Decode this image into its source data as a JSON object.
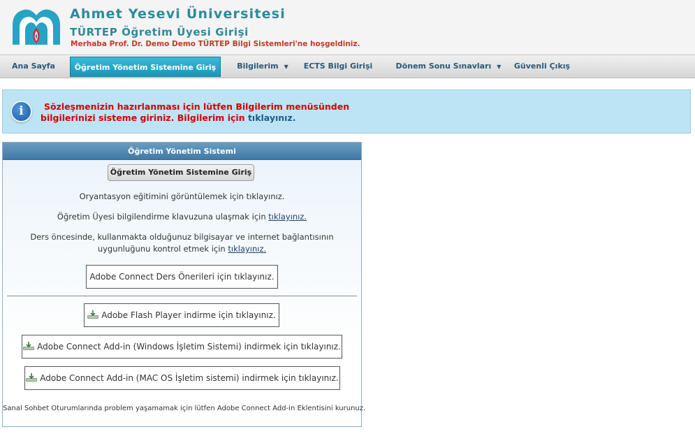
{
  "header": {
    "title": "Ahmet Yesevi Üniversitesi",
    "subtitle": "TÜRTEP Öğretim Üyesi Girişi",
    "welcome": "Merhaba Prof. Dr. Demo Demo TÜRTEP Bilgi Sistemleri'ne hoşgeldiniz."
  },
  "nav": {
    "items": [
      {
        "label": "Ana Sayfa"
      },
      {
        "label": "Öğretim Yönetim Sistemine Giriş"
      },
      {
        "label": "Bilgilerim"
      },
      {
        "label": "ECTS Bilgi Girişi"
      },
      {
        "label": "Dönem Sonu Sınavları"
      },
      {
        "label": "Güvenli Çıkış"
      }
    ],
    "active_index": 1,
    "dropdown_caret": "▼"
  },
  "info": {
    "line1": "Sözleşmenizin hazırlanması için lütfen Bilgilerim menüsünden",
    "line2": "bilgilerinizi sisteme giriniz. Bilgilerim için",
    "link": "tıklayınız.",
    "icon": "i"
  },
  "panel": {
    "title": "Öğretim Yönetim Sistemi",
    "login_button": "Öğretim Yönetim Sistemine Giriş",
    "orientation_text": "Oryantasyon eğitimini görüntülemek için tıklayınız.",
    "guide_text": "Öğretim Üyesi bilgilendirme klavuzuna ulaşmak için",
    "guide_link": "tıklayınız.",
    "check_text_1": "Ders öncesinde, kullanmakta olduğunuz bilgisayar ve internet bağlantısının",
    "check_text_2": "uygunluğunu kontrol etmek için",
    "check_link": "tıklayınız.",
    "adobe_suggestions": "Adobe Connect Ders Önerileri için tıklayınız.",
    "flash_download": "Adobe Flash Player indirme için tıklayınız.",
    "addin_windows": "Adobe Connect Add-in (Windows İşletim Sistemi) indirmek için tıklayınız.",
    "addin_mac": "Adobe Connect Add-in (MAC OS İşletim sistemi) indirmek için tıklayınız.",
    "note": "Sanal Sohbet Oturumlarında problem yaşamamak için lütfen Adobe Connect Add-in Eklentisini kurunuz."
  },
  "colors": {
    "brand": "#2d8a9c",
    "welcome": "#c0392b",
    "nav_active": "#1798b8",
    "info_bg": "#bde4f5",
    "alert_text": "#d40000"
  }
}
